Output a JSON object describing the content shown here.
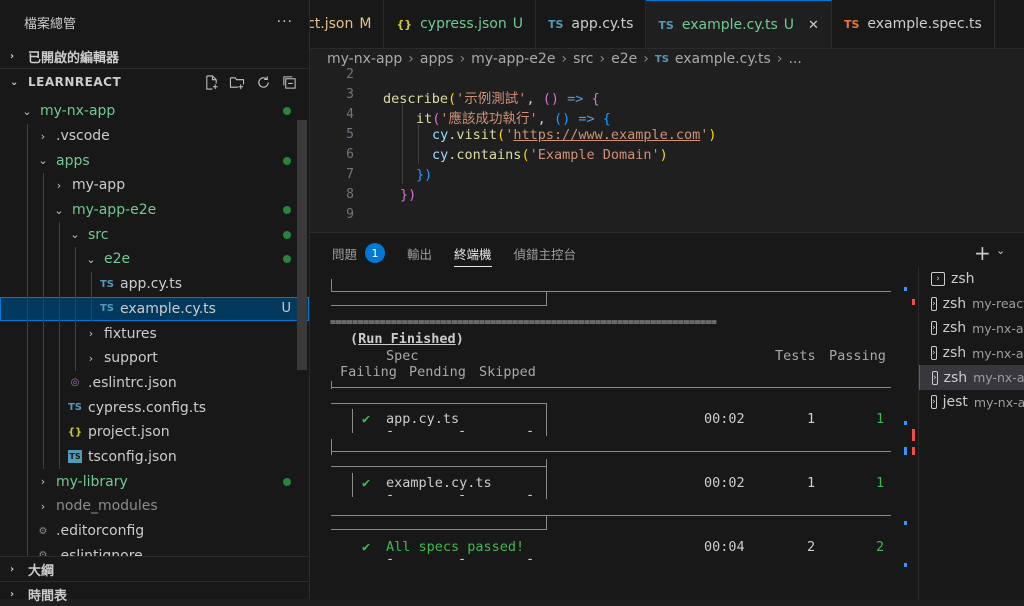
{
  "explorer": {
    "title": "檔案總管",
    "more": "···",
    "open_editors": "已開啟的編輯器",
    "root": "LEARNREACT",
    "tree": [
      {
        "label": "my-nx-app",
        "depth": 1,
        "twisty": "⌄",
        "icon": "",
        "color": "#73c991",
        "dot": true
      },
      {
        "label": ".vscode",
        "depth": 2,
        "twisty": "›",
        "icon": "",
        "color": "#cccccc"
      },
      {
        "label": "apps",
        "depth": 2,
        "twisty": "⌄",
        "icon": "",
        "color": "#73c991",
        "dot": true
      },
      {
        "label": "my-app",
        "depth": 3,
        "twisty": "›",
        "icon": "",
        "color": "#cccccc"
      },
      {
        "label": "my-app-e2e",
        "depth": 3,
        "twisty": "⌄",
        "icon": "",
        "color": "#73c991",
        "dot": true
      },
      {
        "label": "src",
        "depth": 4,
        "twisty": "⌄",
        "icon": "",
        "color": "#73c991",
        "dot": true
      },
      {
        "label": "e2e",
        "depth": 5,
        "twisty": "⌄",
        "icon": "",
        "color": "#73c991",
        "dot": true
      },
      {
        "label": "app.cy.ts",
        "depth": 6,
        "twisty": "",
        "icon": "TS",
        "color": "#cccccc"
      },
      {
        "label": "example.cy.ts",
        "depth": 6,
        "twisty": "",
        "icon": "TS",
        "color": "#cccccc",
        "badge": "U",
        "selected": true
      },
      {
        "label": "fixtures",
        "depth": 5,
        "twisty": "›",
        "icon": "",
        "color": "#cccccc"
      },
      {
        "label": "support",
        "depth": 5,
        "twisty": "›",
        "icon": "",
        "color": "#cccccc"
      },
      {
        "label": ".eslintrc.json",
        "depth": 4,
        "twisty": "",
        "icon": "◎",
        "color": "#cccccc"
      },
      {
        "label": "cypress.config.ts",
        "depth": 4,
        "twisty": "",
        "icon": "TS",
        "color": "#cccccc"
      },
      {
        "label": "project.json",
        "depth": 4,
        "twisty": "",
        "icon": "{}",
        "color": "#cccccc"
      },
      {
        "label": "tsconfig.json",
        "depth": 4,
        "twisty": "",
        "icon": "TS",
        "color": "#cccccc"
      },
      {
        "label": "my-library",
        "depth": 2,
        "twisty": "›",
        "icon": "",
        "color": "#73c991",
        "dot": true
      },
      {
        "label": "node_modules",
        "depth": 2,
        "twisty": "›",
        "icon": "",
        "color": "#8c8c8c"
      },
      {
        "label": ".editorconfig",
        "depth": 2,
        "twisty": "",
        "icon": "⚙",
        "color": "#cccccc"
      },
      {
        "label": ".eslintignore",
        "depth": 2,
        "twisty": "",
        "icon": "⚙",
        "color": "#cccccc"
      }
    ],
    "outline": "大綱",
    "timeline": "時間表"
  },
  "tabs": [
    {
      "label": "project.json",
      "badge": "M",
      "icon": "{}",
      "icon_color": "#cbcb41",
      "badge_color": "#e2c08d"
    },
    {
      "label": "cypress.json",
      "badge": "U",
      "icon": "{}",
      "icon_color": "#cbcb41",
      "badge_color": "#73c991"
    },
    {
      "label": "app.cy.ts",
      "badge": "",
      "icon": "TS",
      "icon_color": "#519aba",
      "badge_color": ""
    },
    {
      "label": "example.cy.ts",
      "badge": "U",
      "icon": "TS",
      "icon_color": "#519aba",
      "badge_color": "#73c991",
      "active": true
    },
    {
      "label": "example.spec.ts",
      "badge": "",
      "icon": "TS",
      "icon_color": "#e37933",
      "badge_color": ""
    }
  ],
  "breadcrumb": [
    "my-nx-app",
    "apps",
    "my-app-e2e",
    "src",
    "e2e",
    "example.cy.ts",
    "..."
  ],
  "editor": {
    "line_numbers": [
      "2",
      "3",
      "4",
      "5",
      "6",
      "7",
      "8",
      "9"
    ],
    "code": {
      "l3_fn": "describe",
      "l3_a": "(",
      "l3_s": "'示例測試'",
      "l3_b": ", ",
      "l3_c": "()",
      "l3_d": " => ",
      "l3_e": "{",
      "l4_fn": "it",
      "l4_a": "(",
      "l4_s": "'應該成功執行'",
      "l4_b": ", ",
      "l4_c": "()",
      "l4_d": " => ",
      "l4_e": "{",
      "l5_obj": "cy",
      "l5_dot": ".",
      "l5_fn": "visit",
      "l5_a": "(",
      "l5_s1": "'",
      "l5_url": "https://www.example.com",
      "l5_s2": "'",
      "l5_b": ")",
      "l6_obj": "cy",
      "l6_dot": ".",
      "l6_fn": "contains",
      "l6_a": "(",
      "l6_s": "'Example Domain'",
      "l6_b": ")",
      "l7": "})",
      "l8": "})"
    }
  },
  "panel": {
    "tabs": [
      "問題",
      "輸出",
      "終端機",
      "偵錯主控台"
    ],
    "problems_count": "1",
    "add": "+",
    "terminal": {
      "run_open": "(",
      "run_title": "Run Finished",
      "run_close": ")",
      "h_spec": "Spec",
      "h_tests": "Tests",
      "h_passing": "Passing",
      "h_failing": "Failing",
      "h_pending": "Pending",
      "h_skipped": "Skipped",
      "equals": "======================================================================",
      "rows": [
        {
          "check": "✔",
          "spec": "app.cy.ts",
          "time": "00:02",
          "tests": "1",
          "passing": "1"
        },
        {
          "check": "✔",
          "spec": "example.cy.ts",
          "time": "00:02",
          "tests": "1",
          "passing": "1"
        }
      ],
      "dash": "-",
      "total": {
        "check": "✔",
        "spec": "All specs passed!",
        "time": "00:04",
        "tests": "2",
        "passing": "2"
      }
    },
    "terminals": [
      {
        "name": "zsh",
        "sub": ""
      },
      {
        "name": "zsh",
        "sub": "my-react"
      },
      {
        "name": "zsh",
        "sub": "my-nx-app"
      },
      {
        "name": "zsh",
        "sub": "my-nx-app"
      },
      {
        "name": "zsh",
        "sub": "my-nx-app",
        "selected": true
      },
      {
        "name": "jest",
        "sub": "my-nx-app"
      }
    ]
  }
}
